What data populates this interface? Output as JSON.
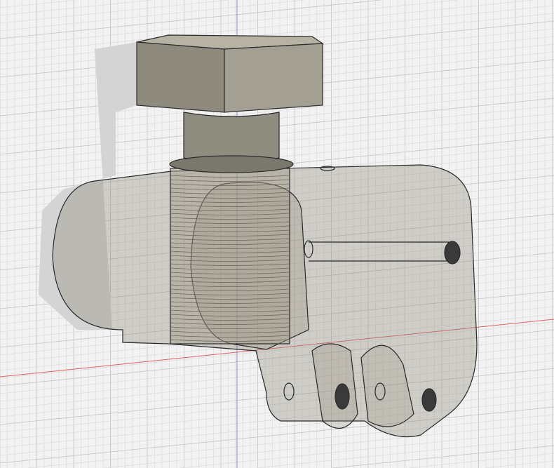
{
  "viewport": {
    "background_color": "#f2f2f2",
    "grid_minor_color": "#dcdcdc",
    "grid_major_color": "#c4c4c4",
    "x_axis_color": "#e06060",
    "z_axis_color": "#8080e0"
  },
  "model": {
    "body_fill": "#8a8470",
    "body_opacity": 0.35,
    "solid_fill": "#8f8c80",
    "edge_color": "#2a2a2a"
  }
}
